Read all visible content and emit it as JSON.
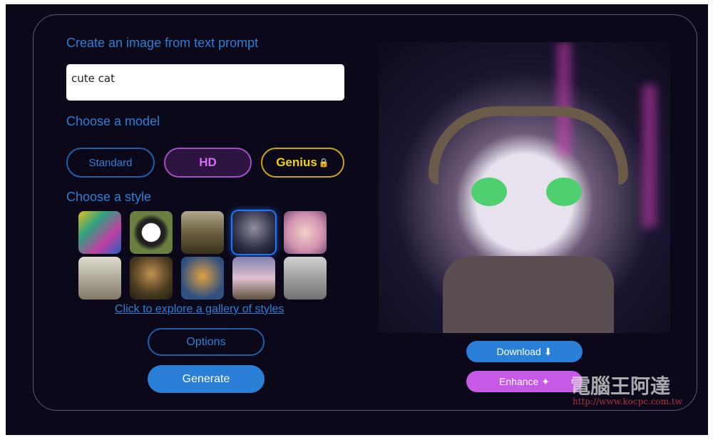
{
  "headings": {
    "prompt": "Create an image from text prompt",
    "model": "Choose a model",
    "style": "Choose a style"
  },
  "prompt": {
    "value": "cute cat"
  },
  "models": [
    {
      "label": "Standard",
      "color": "#2a7fd6"
    },
    {
      "label": "HD",
      "color": "#d46ef2",
      "selected": true
    },
    {
      "label": "Genius",
      "color": "#f3d20a",
      "locked": true
    }
  ],
  "styles": {
    "count": 10,
    "selected_index": 3,
    "gallery_link": "Click to explore a gallery of styles"
  },
  "buttons": {
    "options": "Options",
    "generate": "Generate",
    "download": "Download ⬇",
    "enhance": "Enhance ✦"
  },
  "watermark": {
    "text": "電腦王阿達",
    "url": "http://www.kocpc.com.tw"
  }
}
